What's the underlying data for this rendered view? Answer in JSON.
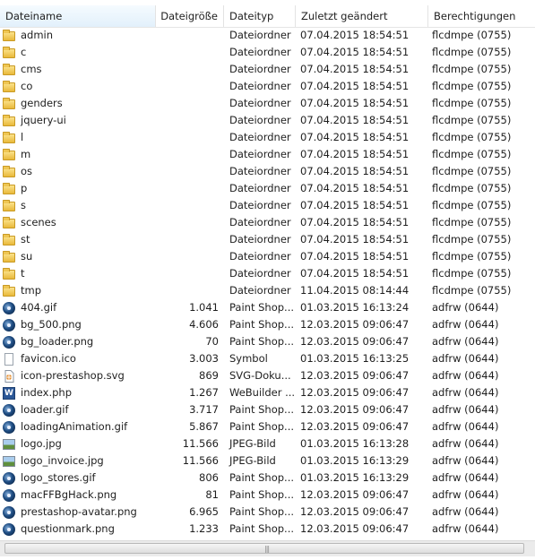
{
  "columns": [
    {
      "key": "name",
      "label": "Dateiname",
      "sorted": true,
      "width": 174
    },
    {
      "key": "size",
      "label": "Dateigröße",
      "width": 76
    },
    {
      "key": "type",
      "label": "Dateityp",
      "width": 80
    },
    {
      "key": "date",
      "label": "Zuletzt geändert",
      "width": 148
    },
    {
      "key": "perm",
      "label": "Berechtigungen",
      "width": 119
    }
  ],
  "sort_indicator": "˄",
  "files": [
    {
      "name": "admin",
      "size": "",
      "type": "Dateiordner",
      "date": "07.04.2015 18:54:51",
      "perm": "flcdmpe (0755)",
      "icon": "folder-icon"
    },
    {
      "name": "c",
      "size": "",
      "type": "Dateiordner",
      "date": "07.04.2015 18:54:51",
      "perm": "flcdmpe (0755)",
      "icon": "folder-icon"
    },
    {
      "name": "cms",
      "size": "",
      "type": "Dateiordner",
      "date": "07.04.2015 18:54:51",
      "perm": "flcdmpe (0755)",
      "icon": "folder-icon"
    },
    {
      "name": "co",
      "size": "",
      "type": "Dateiordner",
      "date": "07.04.2015 18:54:51",
      "perm": "flcdmpe (0755)",
      "icon": "folder-icon"
    },
    {
      "name": "genders",
      "size": "",
      "type": "Dateiordner",
      "date": "07.04.2015 18:54:51",
      "perm": "flcdmpe (0755)",
      "icon": "folder-icon"
    },
    {
      "name": "jquery-ui",
      "size": "",
      "type": "Dateiordner",
      "date": "07.04.2015 18:54:51",
      "perm": "flcdmpe (0755)",
      "icon": "folder-icon"
    },
    {
      "name": "l",
      "size": "",
      "type": "Dateiordner",
      "date": "07.04.2015 18:54:51",
      "perm": "flcdmpe (0755)",
      "icon": "folder-icon"
    },
    {
      "name": "m",
      "size": "",
      "type": "Dateiordner",
      "date": "07.04.2015 18:54:51",
      "perm": "flcdmpe (0755)",
      "icon": "folder-icon"
    },
    {
      "name": "os",
      "size": "",
      "type": "Dateiordner",
      "date": "07.04.2015 18:54:51",
      "perm": "flcdmpe (0755)",
      "icon": "folder-icon"
    },
    {
      "name": "p",
      "size": "",
      "type": "Dateiordner",
      "date": "07.04.2015 18:54:51",
      "perm": "flcdmpe (0755)",
      "icon": "folder-icon"
    },
    {
      "name": "s",
      "size": "",
      "type": "Dateiordner",
      "date": "07.04.2015 18:54:51",
      "perm": "flcdmpe (0755)",
      "icon": "folder-icon"
    },
    {
      "name": "scenes",
      "size": "",
      "type": "Dateiordner",
      "date": "07.04.2015 18:54:51",
      "perm": "flcdmpe (0755)",
      "icon": "folder-icon"
    },
    {
      "name": "st",
      "size": "",
      "type": "Dateiordner",
      "date": "07.04.2015 18:54:51",
      "perm": "flcdmpe (0755)",
      "icon": "folder-icon"
    },
    {
      "name": "su",
      "size": "",
      "type": "Dateiordner",
      "date": "07.04.2015 18:54:51",
      "perm": "flcdmpe (0755)",
      "icon": "folder-icon"
    },
    {
      "name": "t",
      "size": "",
      "type": "Dateiordner",
      "date": "07.04.2015 18:54:51",
      "perm": "flcdmpe (0755)",
      "icon": "folder-icon"
    },
    {
      "name": "tmp",
      "size": "",
      "type": "Dateiordner",
      "date": "11.04.2015 08:14:44",
      "perm": "flcdmpe (0755)",
      "icon": "folder-icon"
    },
    {
      "name": "404.gif",
      "size": "1.041",
      "type": "Paint Shop...",
      "date": "01.03.2015 16:13:24",
      "perm": "adfrw (0644)",
      "icon": "paintshop-icon"
    },
    {
      "name": "bg_500.png",
      "size": "4.606",
      "type": "Paint Shop...",
      "date": "12.03.2015 09:06:47",
      "perm": "adfrw (0644)",
      "icon": "paintshop-icon"
    },
    {
      "name": "bg_loader.png",
      "size": "70",
      "type": "Paint Shop...",
      "date": "12.03.2015 09:06:47",
      "perm": "adfrw (0644)",
      "icon": "paintshop-icon"
    },
    {
      "name": "favicon.ico",
      "size": "3.003",
      "type": "Symbol",
      "date": "01.03.2015 16:13:25",
      "perm": "adfrw (0644)",
      "icon": "document-icon"
    },
    {
      "name": "icon-prestashop.svg",
      "size": "869",
      "type": "SVG-Doku...",
      "date": "12.03.2015 09:06:47",
      "perm": "adfrw (0644)",
      "icon": "svg-document-icon"
    },
    {
      "name": "index.php",
      "size": "1.267",
      "type": "WeBuilder ...",
      "date": "12.03.2015 09:06:47",
      "perm": "adfrw (0644)",
      "icon": "webuilder-icon"
    },
    {
      "name": "loader.gif",
      "size": "3.717",
      "type": "Paint Shop...",
      "date": "12.03.2015 09:06:47",
      "perm": "adfrw (0644)",
      "icon": "paintshop-icon"
    },
    {
      "name": "loadingAnimation.gif",
      "size": "5.867",
      "type": "Paint Shop...",
      "date": "12.03.2015 09:06:47",
      "perm": "adfrw (0644)",
      "icon": "paintshop-icon"
    },
    {
      "name": "logo.jpg",
      "size": "11.566",
      "type": "JPEG-Bild",
      "date": "01.03.2015 16:13:28",
      "perm": "adfrw (0644)",
      "icon": "jpeg-image-icon"
    },
    {
      "name": "logo_invoice.jpg",
      "size": "11.566",
      "type": "JPEG-Bild",
      "date": "01.03.2015 16:13:29",
      "perm": "adfrw (0644)",
      "icon": "jpeg-image-icon"
    },
    {
      "name": "logo_stores.gif",
      "size": "806",
      "type": "Paint Shop...",
      "date": "01.03.2015 16:13:29",
      "perm": "adfrw (0644)",
      "icon": "paintshop-icon"
    },
    {
      "name": "macFFBgHack.png",
      "size": "81",
      "type": "Paint Shop...",
      "date": "12.03.2015 09:06:47",
      "perm": "adfrw (0644)",
      "icon": "paintshop-icon"
    },
    {
      "name": "prestashop-avatar.png",
      "size": "6.965",
      "type": "Paint Shop...",
      "date": "12.03.2015 09:06:47",
      "perm": "adfrw (0644)",
      "icon": "paintshop-icon"
    },
    {
      "name": "questionmark.png",
      "size": "1.233",
      "type": "Paint Shop...",
      "date": "12.03.2015 09:06:47",
      "perm": "adfrw (0644)",
      "icon": "paintshop-icon"
    }
  ],
  "scrollbar": {
    "grip": "|||"
  }
}
